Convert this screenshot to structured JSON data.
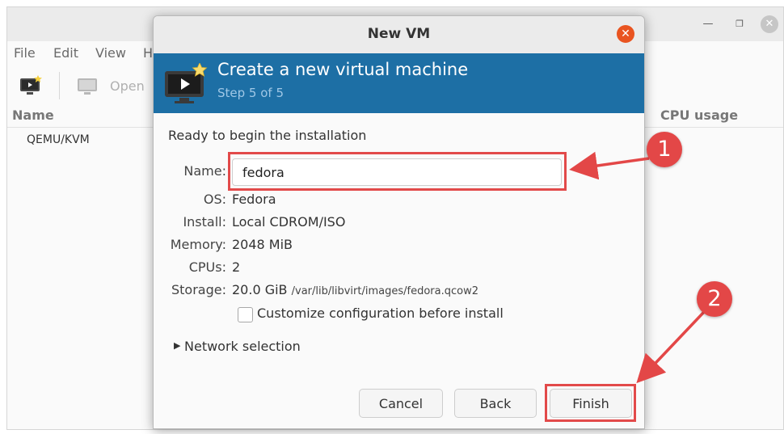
{
  "main_window": {
    "menus": [
      "File",
      "Edit",
      "View",
      "H"
    ],
    "toolbar": {
      "open_label": "Open"
    },
    "columns": {
      "name": "Name",
      "cpu_usage": "CPU usage"
    },
    "rows": [
      {
        "name": "QEMU/KVM"
      }
    ]
  },
  "dialog": {
    "title": "New VM",
    "banner": {
      "heading": "Create a new virtual machine",
      "step": "Step 5 of 5"
    },
    "ready_text": "Ready to begin the installation",
    "fields": {
      "name_label": "Name:",
      "name_value": "fedora",
      "os_label": "OS:",
      "os_value": "Fedora",
      "install_label": "Install:",
      "install_value": "Local CDROM/ISO",
      "memory_label": "Memory:",
      "memory_value": "2048 MiB",
      "cpus_label": "CPUs:",
      "cpus_value": "2",
      "storage_label": "Storage:",
      "storage_size": "20.0 GiB",
      "storage_path": "/var/lib/libvirt/images/fedora.qcow2"
    },
    "customize_label": "Customize configuration before install",
    "customize_checked": false,
    "network_label": "Network selection",
    "buttons": {
      "cancel": "Cancel",
      "back": "Back",
      "finish": "Finish"
    }
  },
  "annotations": {
    "callout_1": "1",
    "callout_2": "2",
    "color": "#e34747"
  },
  "colors": {
    "banner": "#1d6fa5",
    "close_button": "#e95420",
    "highlight": "#e24a4a"
  }
}
